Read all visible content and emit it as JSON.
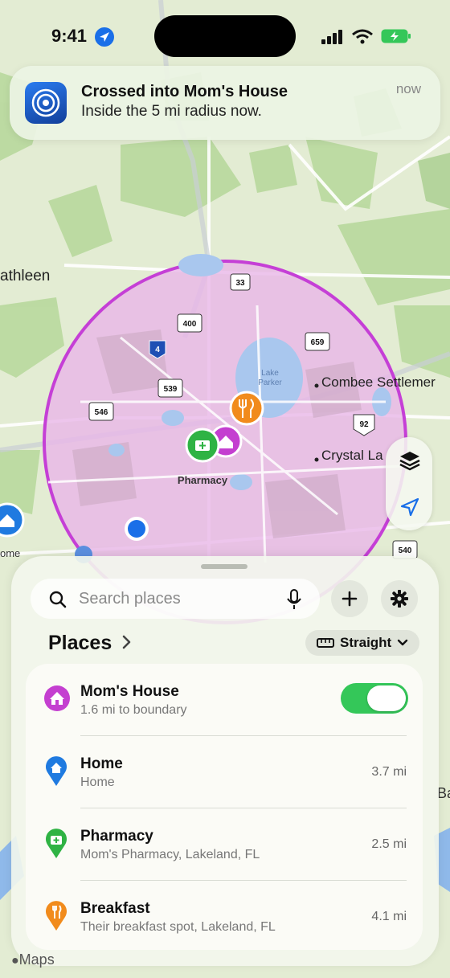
{
  "status_bar": {
    "time": "9:41"
  },
  "notification": {
    "title": "Crossed into Mom's House",
    "body": "Inside the 5 mi radius now.",
    "time": "now"
  },
  "map": {
    "labels": {
      "kathleen": "athleen",
      "combee": "Combee Settlemer",
      "crystal": "Crystal La",
      "lake_parker": [
        "Lake",
        "Parker"
      ],
      "pharmacy_pin": "Pharmacy",
      "home_pin": "ome",
      "edge_ba": "Ba"
    },
    "shields": {
      "s33": "33",
      "s400": "400",
      "i4": "4",
      "s659": "659",
      "s539": "539",
      "s546": "546",
      "us92": "92",
      "s540": "540"
    },
    "colors": {
      "geofence": "#c53fd6",
      "geofence_fill": "#e8b6e8",
      "home": "#1f7ae0",
      "pharmacy": "#2fb344",
      "breakfast": "#f18b1c",
      "moms_house": "#c43fd0"
    }
  },
  "sheet": {
    "search_placeholder": "Search places",
    "places_title": "Places",
    "route_mode": "Straight",
    "places": [
      {
        "name": "Mom's House",
        "subtitle": "1.6 mi to boundary",
        "toggle_on": true,
        "icon": "house-icon"
      },
      {
        "name": "Home",
        "subtitle": "Home",
        "distance": "3.7 mi",
        "icon": "house-icon"
      },
      {
        "name": "Pharmacy",
        "subtitle": "Mom's Pharmacy, Lakeland, FL",
        "distance": "2.5 mi",
        "icon": "medical-kit-icon"
      },
      {
        "name": "Breakfast",
        "subtitle": "Their breakfast spot, Lakeland, FL",
        "distance": "4.1 mi",
        "icon": "fork-knife-icon"
      }
    ]
  },
  "legal": "Maps"
}
